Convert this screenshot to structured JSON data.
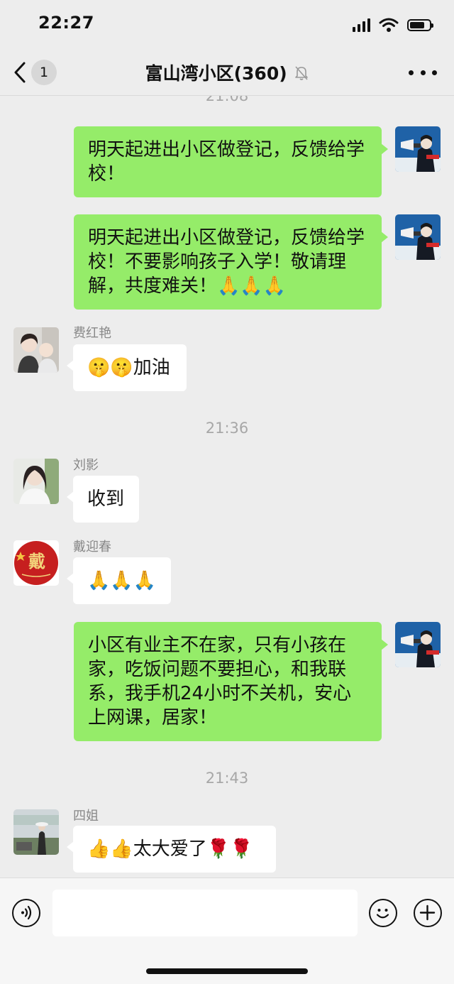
{
  "status_bar": {
    "time": "22:27",
    "icons": [
      "signal-icon",
      "wifi-icon",
      "battery-icon"
    ]
  },
  "nav": {
    "back_icon": "chevron-left-icon",
    "unread_count": "1",
    "title": "富山湾小区(360)",
    "mute_icon": "bell-muted-icon",
    "more_icon": "more-dots-icon"
  },
  "timestamps": {
    "t0": "21:08",
    "t1": "21:36",
    "t2": "21:43"
  },
  "messages": [
    {
      "direction": "out",
      "text": "明天起进出小区做登记，反馈给学校！"
    },
    {
      "direction": "out",
      "text": "明天起进出小区做登记，反馈给学校！不要影响孩子入学！敬请理解，共度难关！🙏🙏🙏"
    },
    {
      "direction": "in",
      "sender": "费红艳",
      "text": "🤫🤫加油"
    },
    {
      "direction": "in",
      "sender": "刘影",
      "text": "收到"
    },
    {
      "direction": "in",
      "sender": "戴迎春",
      "text": "🙏🙏🙏",
      "avatar_text": "戴"
    },
    {
      "direction": "out",
      "text": "小区有业主不在家，只有小孩在家，吃饭问题不要担心，和我联系，我手机24小时不关机，安心上网课，居家！"
    },
    {
      "direction": "in",
      "sender": "四姐",
      "text": "👍👍太大爱了🌹🌹"
    }
  ],
  "input_bar": {
    "voice_icon": "voice-icon",
    "emoji_icon": "emoji-icon",
    "add_icon": "plus-icon",
    "placeholder": ""
  },
  "colors": {
    "background": "#ededed",
    "outgoing_bubble": "#95ec69",
    "incoming_bubble": "#ffffff",
    "meta_text": "#a7a7a7"
  }
}
